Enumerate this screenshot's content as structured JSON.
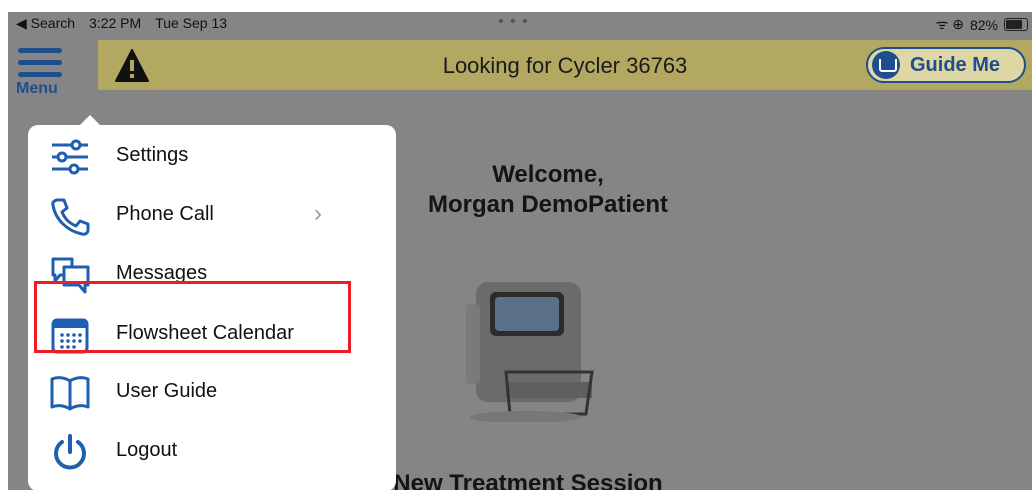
{
  "status_bar": {
    "back": "◀ Search",
    "time": "3:22 PM",
    "date": "Tue Sep 13",
    "dots": "• • •",
    "signal": "ᯤ ⊕",
    "battery": "82%"
  },
  "header": {
    "menu_label": "Menu",
    "banner_text": "Looking for Cycler 36763",
    "guide_label": "Guide Me",
    "banner_color": "#B3A862",
    "accent_color": "#1f4e8c"
  },
  "main": {
    "welcome_line1": "Welcome,",
    "welcome_line2": "Morgan DemoPatient",
    "new_session": "New Treatment Session"
  },
  "menu": {
    "items": [
      {
        "label": "Settings",
        "icon": "sliders-icon"
      },
      {
        "label": "Phone Call",
        "icon": "phone-icon",
        "chevron": "›"
      },
      {
        "label": "Messages",
        "icon": "chat-bubbles-icon"
      },
      {
        "label": "Flowsheet Calendar",
        "icon": "calendar-icon",
        "highlighted": true
      },
      {
        "label": "User Guide",
        "icon": "open-book-icon"
      },
      {
        "label": "Logout",
        "icon": "power-icon"
      }
    ]
  },
  "highlight_color": "#ee1c24"
}
